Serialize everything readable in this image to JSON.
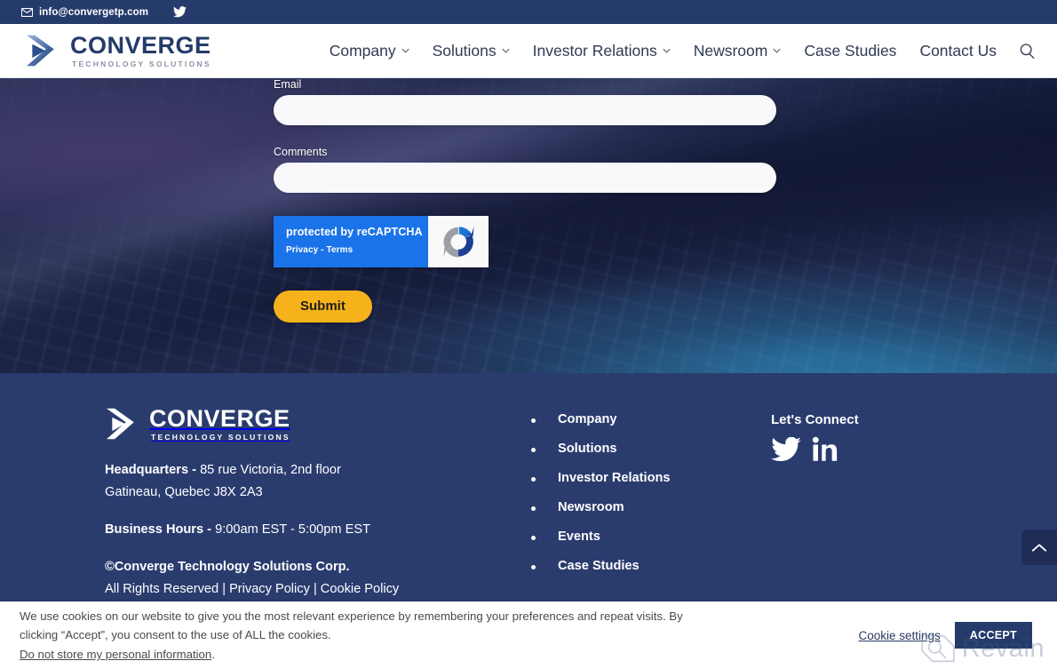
{
  "topbar": {
    "email": "info@convergetp.com",
    "mail_icon": "mail-icon",
    "twitter_icon": "twitter-icon"
  },
  "header": {
    "logo": {
      "main": "CONVERGE",
      "sub": "TECHNOLOGY SOLUTIONS",
      "mark_icon": "converge-chevron-icon"
    },
    "nav": [
      {
        "label": "Company",
        "has_dropdown": true
      },
      {
        "label": "Solutions",
        "has_dropdown": true
      },
      {
        "label": "Investor Relations",
        "has_dropdown": true
      },
      {
        "label": "Newsroom",
        "has_dropdown": true
      },
      {
        "label": "Case Studies",
        "has_dropdown": false
      },
      {
        "label": "Contact Us",
        "has_dropdown": false
      }
    ],
    "search_icon": "search-icon"
  },
  "form": {
    "email_label": "Email",
    "email_value": "",
    "email_placeholder": "",
    "comments_label": "Comments",
    "comments_value": "",
    "comments_placeholder": "",
    "recaptcha": {
      "title": "protected by reCAPTCHA",
      "subtitle": "Privacy - Terms",
      "logo_icon": "recaptcha-logo-icon",
      "badge_color": "#1a73e8"
    },
    "submit_label": "Submit",
    "submit_color": "#f6b21b"
  },
  "footer": {
    "logo": {
      "main": "CONVERGE",
      "sub": "TECHNOLOGY SOLUTIONS",
      "mark_icon": "converge-chevron-icon"
    },
    "hq_label": "Headquarters - ",
    "hq_line1": "85 rue Victoria, 2nd floor",
    "hq_line2": "Gatineau, Quebec J8X 2A3",
    "hours_label": "Business Hours - ",
    "hours_value": "9:00am EST - 5:00pm EST",
    "copyright": "©Converge Technology Solutions Corp.",
    "legal_rights": "All Rights Reserved | ",
    "legal_privacy": "Privacy Policy",
    "legal_sep": " | ",
    "legal_cookie": "Cookie Policy",
    "links": [
      "Company",
      "Solutions",
      "Investor Relations",
      "Newsroom",
      "Events",
      "Case Studies"
    ],
    "connect_title": "Let's Connect",
    "social": [
      {
        "name": "twitter-icon"
      },
      {
        "name": "linkedin-icon"
      }
    ],
    "background_color": "#2a3c6e"
  },
  "scroll_top": {
    "icon": "chevron-up-icon"
  },
  "cookie_banner": {
    "text": "We use cookies on our website to give you the most relevant experience by remembering your preferences and repeat visits. By clicking “Accept”, you consent to the use of ALL the cookies.",
    "optout_link": "Do not store my personal information",
    "optout_period": ".",
    "settings_label": "Cookie settings",
    "accept_label": "ACCEPT",
    "accept_color": "#253b6b"
  },
  "watermark": {
    "text": "Revain",
    "icon": "revain-logo-icon"
  }
}
